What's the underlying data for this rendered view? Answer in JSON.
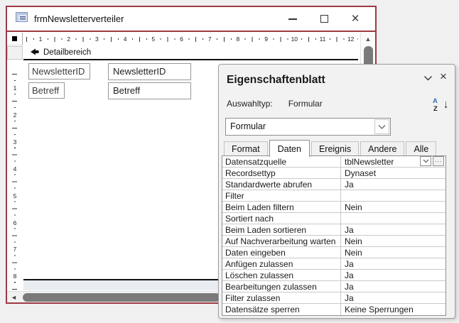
{
  "colors": {
    "window_border": "#9c3a42",
    "sort_a_blue": "#2f6fb5",
    "scroll_thumb": "#7a7a7a",
    "panel_bg": "#f2f2f2"
  },
  "icons": {
    "close": "×",
    "panel_close": "×",
    "up_arrow": "▲",
    "left_arrow": "◄",
    "ellipsis": "...",
    "sort_a": "A",
    "sort_z": "Z",
    "sort_arrow": "↓"
  },
  "form_window": {
    "title": "frmNewsletterverteiler",
    "section_label": "Detailbereich",
    "ruler_h_numbers": [
      1,
      2,
      3,
      4,
      5,
      6,
      7,
      8,
      9,
      10,
      11,
      12
    ],
    "ruler_v_numbers": [
      1,
      2,
      3,
      4,
      5,
      6,
      7,
      8
    ],
    "fields": [
      {
        "label": "NewsletterID",
        "value": "NewsletterID"
      },
      {
        "label": "Betreff",
        "value": "Betreff"
      }
    ]
  },
  "property_sheet": {
    "title": "Eigenschaftenblatt",
    "selection_label": "Auswahltyp:",
    "selection_value": "Formular",
    "combo_value": "Formular",
    "tabs": [
      {
        "label": "Format"
      },
      {
        "label": "Daten",
        "active": true
      },
      {
        "label": "Ereignis"
      },
      {
        "label": "Andere"
      },
      {
        "label": "Alle"
      }
    ],
    "rows": [
      {
        "label": "Datensatzquelle",
        "value": "tblNewsletter",
        "buttons": true
      },
      {
        "label": "Recordsettyp",
        "value": "Dynaset"
      },
      {
        "label": "Standardwerte abrufen",
        "value": "Ja"
      },
      {
        "label": "Filter",
        "value": ""
      },
      {
        "label": "Beim Laden filtern",
        "value": "Nein"
      },
      {
        "label": "Sortiert nach",
        "value": ""
      },
      {
        "label": "Beim Laden sortieren",
        "value": "Ja"
      },
      {
        "label": "Auf Nachverarbeitung warten",
        "value": "Nein"
      },
      {
        "label": "Daten eingeben",
        "value": "Nein"
      },
      {
        "label": "Anfügen zulassen",
        "value": "Ja"
      },
      {
        "label": "Löschen zulassen",
        "value": "Ja"
      },
      {
        "label": "Bearbeitungen zulassen",
        "value": "Ja"
      },
      {
        "label": "Filter zulassen",
        "value": "Ja"
      },
      {
        "label": "Datensätze sperren",
        "value": "Keine Sperrungen"
      }
    ]
  }
}
